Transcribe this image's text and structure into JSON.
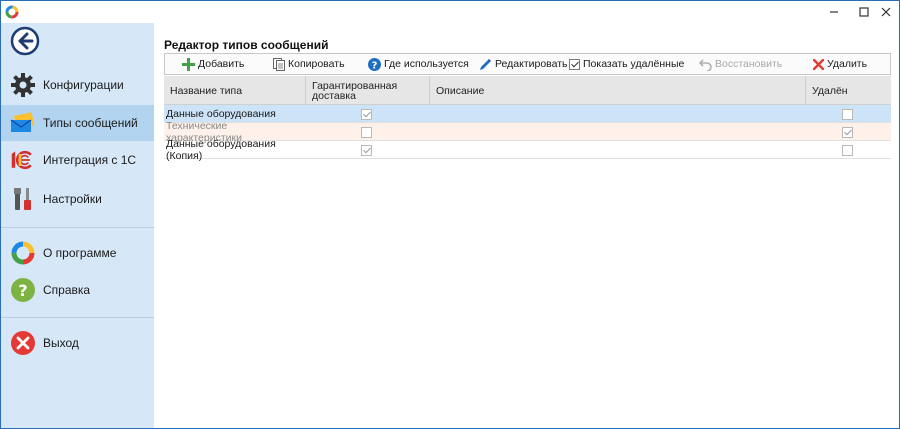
{
  "window": {
    "title_icon": "app-ring-icon",
    "controls": [
      "minimize-icon",
      "maximize-icon",
      "close-icon"
    ]
  },
  "sidebar": {
    "back_icon": "arrow-left-icon",
    "items": [
      {
        "label": "Конфигурации",
        "icon": "gear-icon",
        "active": false
      },
      {
        "label": "Типы сообщений",
        "icon": "envelope-icon",
        "active": true
      },
      {
        "label": "Интеграция с 1С",
        "icon": "1c-logo-icon",
        "active": false
      },
      {
        "label": "Настройки",
        "icon": "tools-icon",
        "active": false
      },
      {
        "label": "О программе",
        "icon": "app-ring-icon",
        "active": false
      },
      {
        "label": "Справка",
        "icon": "question-icon",
        "active": false
      },
      {
        "label": "Выход",
        "icon": "exit-icon",
        "active": false
      }
    ]
  },
  "main": {
    "title": "Редактор типов сообщений",
    "toolbar": {
      "add": "Добавить",
      "copy": "Копировать",
      "where_used": "Где используется",
      "edit": "Редактировать",
      "show_deleted": "Показать удалённые",
      "show_deleted_checked": true,
      "restore": "Восстановить",
      "delete": "Удалить"
    },
    "columns": {
      "name": "Название типа",
      "guaranteed_line1": "Гарантированная",
      "guaranteed_line2": "доставка",
      "description": "Описание",
      "deleted": "Удалён"
    },
    "rows": [
      {
        "name": "Данные оборудования",
        "guaranteed": true,
        "description": "",
        "deleted": false,
        "state": "selected"
      },
      {
        "name": "Технические характеристики",
        "guaranteed": false,
        "description": "",
        "deleted": true,
        "state": "deleted"
      },
      {
        "name": "Данные оборудования (Копия)",
        "guaranteed": true,
        "description": "",
        "deleted": false,
        "state": "normal"
      }
    ]
  },
  "colors": {
    "accent": "#2a6db5",
    "sidebar_bg": "#d6e8f8",
    "sidebar_active": "#b3d4f0",
    "row_selected": "#cde3f7",
    "row_deleted": "#fdf1ea"
  }
}
